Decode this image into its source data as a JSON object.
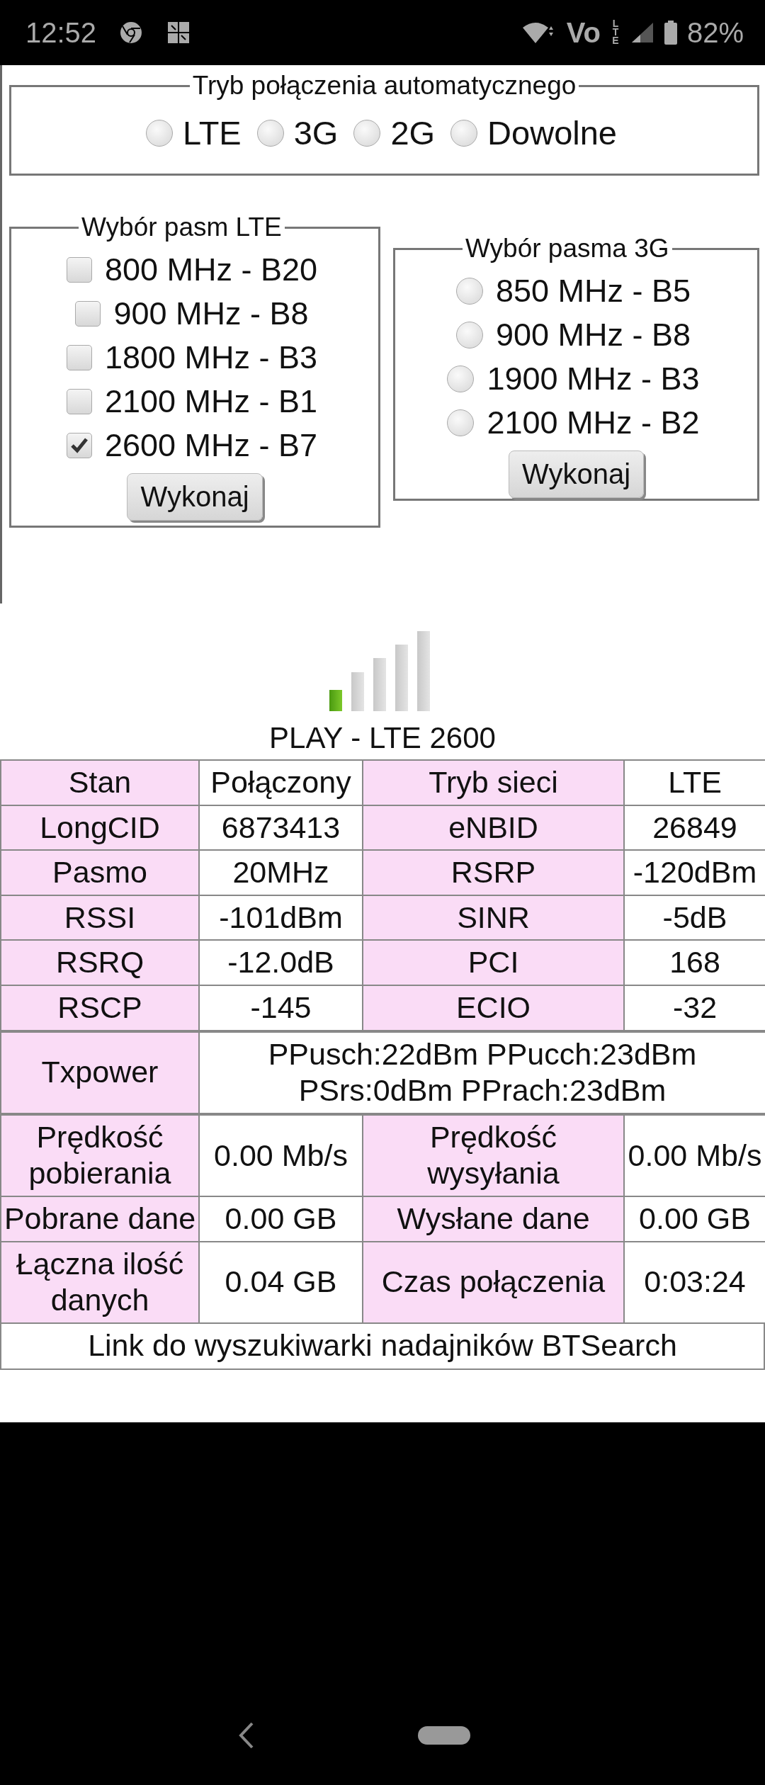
{
  "status_bar": {
    "time": "12:52",
    "volte_label": "Vo",
    "lte_label": "LTE",
    "battery": "82%"
  },
  "auto_mode": {
    "legend": "Tryb połączenia automatycznego",
    "options": [
      {
        "label": "LTE",
        "selected": false
      },
      {
        "label": "3G",
        "selected": false
      },
      {
        "label": "2G",
        "selected": false
      },
      {
        "label": "Dowolne",
        "selected": false
      }
    ]
  },
  "lte_bands": {
    "legend": "Wybór pasm LTE",
    "options": [
      {
        "label": "800 MHz - B20",
        "checked": false
      },
      {
        "label": "900 MHz - B8",
        "checked": false
      },
      {
        "label": "1800 MHz - B3",
        "checked": false
      },
      {
        "label": "2100 MHz - B1",
        "checked": false
      },
      {
        "label": "2600 MHz - B7",
        "checked": true
      }
    ],
    "button": "Wykonaj"
  },
  "umts_bands": {
    "legend": "Wybór pasma 3G",
    "options": [
      {
        "label": "850 MHz - B5",
        "selected": false
      },
      {
        "label": "900 MHz - B8",
        "selected": false
      },
      {
        "label": "1900 MHz - B3",
        "selected": false
      },
      {
        "label": "2100 MHz - B2",
        "selected": false
      }
    ],
    "button": "Wykonaj"
  },
  "network_title": "PLAY - LTE 2600",
  "table": {
    "rows": [
      [
        {
          "kind": "label",
          "text": "Stan"
        },
        {
          "kind": "value",
          "text": "Połączony"
        },
        {
          "kind": "label",
          "text": "Tryb sieci"
        },
        {
          "kind": "value",
          "text": "LTE"
        }
      ],
      [
        {
          "kind": "label",
          "text": "LongCID"
        },
        {
          "kind": "value",
          "text": "6873413"
        },
        {
          "kind": "label",
          "text": "eNBID"
        },
        {
          "kind": "value",
          "text": "26849"
        }
      ],
      [
        {
          "kind": "label",
          "text": "Pasmo"
        },
        {
          "kind": "value",
          "text": "20MHz"
        },
        {
          "kind": "label",
          "text": "RSRP"
        },
        {
          "kind": "value",
          "text": "-120dBm"
        }
      ],
      [
        {
          "kind": "label",
          "text": "RSSI"
        },
        {
          "kind": "value",
          "text": "-101dBm"
        },
        {
          "kind": "label",
          "text": "SINR"
        },
        {
          "kind": "value",
          "text": "-5dB"
        }
      ],
      [
        {
          "kind": "label",
          "text": "RSRQ"
        },
        {
          "kind": "value",
          "text": "-12.0dB"
        },
        {
          "kind": "label",
          "text": "PCI"
        },
        {
          "kind": "value",
          "text": "168"
        }
      ],
      [
        {
          "kind": "label",
          "text": "RSCP"
        },
        {
          "kind": "value",
          "text": "-145"
        },
        {
          "kind": "label",
          "text": "ECIO"
        },
        {
          "kind": "value",
          "text": "-32"
        }
      ]
    ]
  },
  "txpower_row": {
    "label": "Txpower",
    "value": "PPusch:22dBm PPucch:23dBm PSrs:0dBm PPrach:23dBm"
  },
  "table_lower": {
    "rows": [
      [
        {
          "kind": "label",
          "text": "Prędkość pobierania"
        },
        {
          "kind": "value",
          "text": "0.00 Mb/s"
        },
        {
          "kind": "label",
          "text": "Prędkość wysyłania"
        },
        {
          "kind": "value",
          "text": "0.00 Mb/s"
        }
      ],
      [
        {
          "kind": "label",
          "text": "Pobrane dane"
        },
        {
          "kind": "value",
          "text": "0.00 GB"
        },
        {
          "kind": "label",
          "text": "Wysłane dane"
        },
        {
          "kind": "value",
          "text": "0.00 GB"
        }
      ],
      [
        {
          "kind": "label",
          "text": "Łączna ilość danych"
        },
        {
          "kind": "value",
          "text": "0.04 GB"
        },
        {
          "kind": "label",
          "text": "Czas połączenia"
        },
        {
          "kind": "value",
          "text": "0:03:24"
        }
      ]
    ]
  },
  "btsearch_link": "Link do wyszukiwarki nadajników BTSearch"
}
